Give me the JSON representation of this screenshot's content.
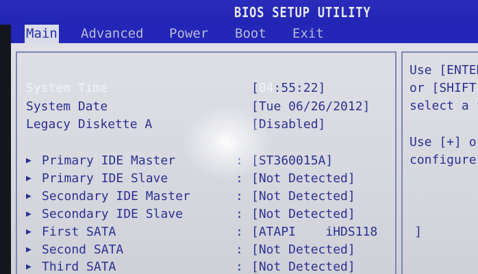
{
  "title": "BIOS SETUP UTILITY",
  "menu": {
    "main": "Main",
    "advanced": "Advanced",
    "power": "Power",
    "boot": "Boot",
    "exit": "Exit"
  },
  "settings": {
    "system_time": {
      "label": "System Time",
      "value_open": "[",
      "value_cursor": "04",
      "value_rest": ":55:22]"
    },
    "system_date": {
      "label": "System Date",
      "value": "[Tue 06/26/2012]"
    },
    "legacy_diskette": {
      "label": "Legacy Diskette A",
      "value": "[Disabled]"
    }
  },
  "devices": [
    {
      "label": "Primary IDE Master",
      "value": "[ST360015A]"
    },
    {
      "label": "Primary IDE Slave",
      "value": "[Not Detected]"
    },
    {
      "label": "Secondary IDE Master",
      "value": "[Not Detected]"
    },
    {
      "label": "Secondary IDE Slave",
      "value": "[Not Detected]"
    },
    {
      "label": "First SATA",
      "value": "[ATAPI    iHDS118     ]"
    },
    {
      "label": "Second SATA",
      "value": "[Not Detected]"
    },
    {
      "label": "Third SATA",
      "value": "[Not Detected]"
    }
  ],
  "separator": ":",
  "submenu_arrow": "▶",
  "help": {
    "line1": "Use [ENTER",
    "line2": "or [SHIFT-",
    "line3": "select a f",
    "line4": "Use [+] or",
    "line5": "configure s"
  },
  "colors": {
    "title_bar": "#2a2bbb",
    "panel": "#dfe0e6",
    "text": "#2b3191",
    "highlight": "#f1f2f8"
  }
}
